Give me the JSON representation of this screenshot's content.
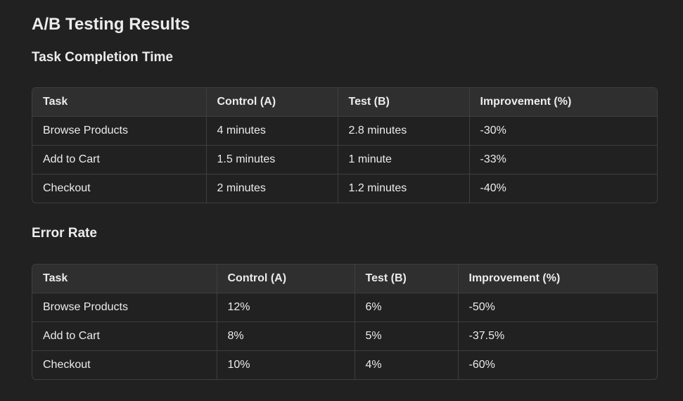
{
  "page_title": "A/B Testing Results",
  "sections": [
    {
      "title": "Task Completion Time",
      "headers": [
        "Task",
        "Control (A)",
        "Test (B)",
        "Improvement (%)"
      ],
      "rows": [
        [
          "Browse Products",
          "4 minutes",
          "2.8 minutes",
          "-30%"
        ],
        [
          "Add to Cart",
          "1.5 minutes",
          "1 minute",
          "-33%"
        ],
        [
          "Checkout",
          "2 minutes",
          "1.2 minutes",
          "-40%"
        ]
      ]
    },
    {
      "title": "Error Rate",
      "headers": [
        "Task",
        "Control (A)",
        "Test (B)",
        "Improvement (%)"
      ],
      "rows": [
        [
          "Browse Products",
          "12%",
          "6%",
          "-50%"
        ],
        [
          "Add to Cart",
          "8%",
          "5%",
          "-37.5%"
        ],
        [
          "Checkout",
          "10%",
          "4%",
          "-60%"
        ]
      ]
    }
  ]
}
